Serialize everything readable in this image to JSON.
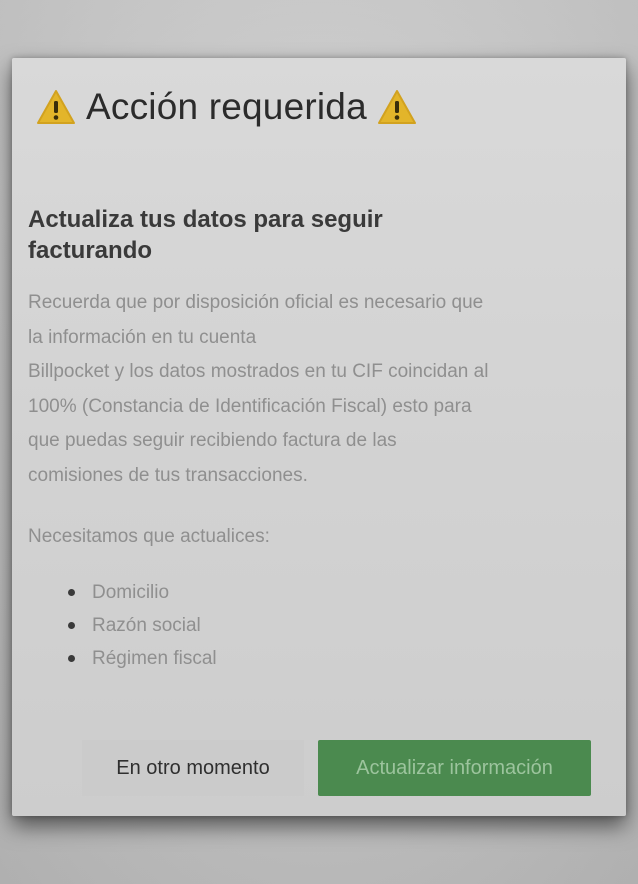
{
  "modal": {
    "title": "Acción requerida",
    "title_icon": "warning-icon",
    "subtitle": "Actualiza tus datos para seguir facturando",
    "body_lines": [
      "Recuerda que por disposición oficial es necesario que",
      "la información en tu cuenta",
      "Billpocket y los datos mostrados en tu CIF coincidan al",
      "100% (Constancia de Identificación Fiscal) esto para",
      "que puedas seguir recibiendo factura de las",
      "comisiones de tus transacciones."
    ],
    "need_label": "Necesitamos que actualices:",
    "requirements": [
      "Domicilio",
      "Razón social",
      "Régimen fiscal"
    ],
    "secondary_button": "En otro momento",
    "primary_button": "Actualizar información"
  },
  "colors": {
    "primary_button": "#4b8a4f",
    "warning_icon": "#e3b52a"
  }
}
